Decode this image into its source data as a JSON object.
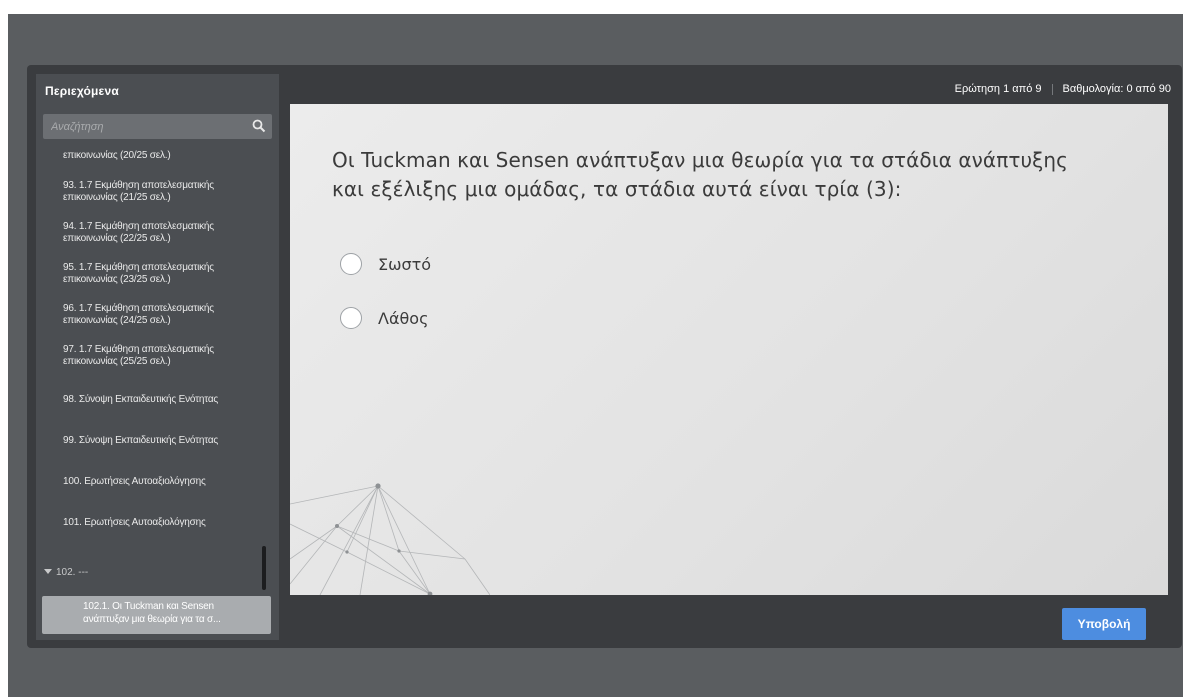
{
  "sidebar": {
    "title": "Περιεχόμενα",
    "search_placeholder": "Αναζήτηση",
    "items": [
      {
        "lines": [
          "επικοινωνίας (20/25 σελ.)"
        ]
      },
      {
        "lines": [
          "93. 1.7 Εκμάθηση αποτελεσματικής",
          "επικοινωνίας (21/25 σελ.)"
        ]
      },
      {
        "lines": [
          "94. 1.7 Εκμάθηση αποτελεσματικής",
          "επικοινωνίας (22/25 σελ.)"
        ]
      },
      {
        "lines": [
          "95. 1.7 Εκμάθηση αποτελεσματικής",
          "επικοινωνίας (23/25 σελ.)"
        ]
      },
      {
        "lines": [
          "96. 1.7 Εκμάθηση αποτελεσματικής",
          "επικοινωνίας (24/25 σελ.)"
        ]
      },
      {
        "lines": [
          "97. 1.7 Εκμάθηση αποτελεσματικής",
          "επικοινωνίας (25/25 σελ.)"
        ]
      },
      {
        "lines": [
          "98. Σύνοψη Εκπαιδευτικής Ενότητας"
        ]
      },
      {
        "lines": [
          "99. Σύνοψη Εκπαιδευτικής Ενότητας"
        ]
      },
      {
        "lines": [
          "100. Ερωτήσεις Αυτοαξιολόγησης"
        ]
      },
      {
        "lines": [
          "101. Ερωτήσεις Αυτοαξιολόγησης"
        ]
      }
    ],
    "group_label": "102. ---",
    "current_item": {
      "lines": [
        "102.1. Οι Tuckman και Sensen",
        "ανάπτυξαν μια θεωρία για τα σ..."
      ]
    }
  },
  "status": {
    "question_counter": "Ερώτηση 1 από 9",
    "score": "Βαθμολογία: 0 από 90"
  },
  "question": {
    "text_lines": [
      "Οι Tuckman και Sensen ανάπτυξαν μια θεωρία για τα στάδια ανάπτυξης",
      "και εξέλιξης μια ομάδας, τα στάδια αυτά είναι τρία (3):"
    ],
    "options": [
      "Σωστό",
      "Λάθος"
    ]
  },
  "submit_label": "Υποβολή"
}
